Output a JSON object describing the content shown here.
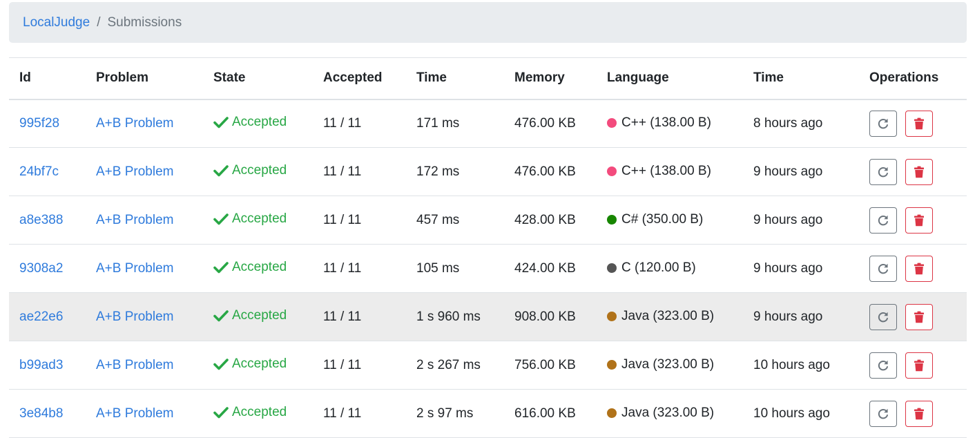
{
  "breadcrumb": {
    "home": "LocalJudge",
    "separator": "/",
    "current": "Submissions"
  },
  "table": {
    "headers": [
      "Id",
      "Problem",
      "State",
      "Accepted",
      "Time",
      "Memory",
      "Language",
      "Time",
      "Operations"
    ],
    "rows": [
      {
        "id": "995f28",
        "problem": "A+B Problem",
        "state": "Accepted",
        "accepted": "11 / 11",
        "time": "171 ms",
        "memory": "476.00 KB",
        "language": "C++ (138.00 B)",
        "lang_color": "#f34b7d",
        "submitted": "8 hours ago"
      },
      {
        "id": "24bf7c",
        "problem": "A+B Problem",
        "state": "Accepted",
        "accepted": "11 / 11",
        "time": "172 ms",
        "memory": "476.00 KB",
        "language": "C++ (138.00 B)",
        "lang_color": "#f34b7d",
        "submitted": "9 hours ago"
      },
      {
        "id": "a8e388",
        "problem": "A+B Problem",
        "state": "Accepted",
        "accepted": "11 / 11",
        "time": "457 ms",
        "memory": "428.00 KB",
        "language": "C# (350.00 B)",
        "lang_color": "#178600",
        "submitted": "9 hours ago"
      },
      {
        "id": "9308a2",
        "problem": "A+B Problem",
        "state": "Accepted",
        "accepted": "11 / 11",
        "time": "105 ms",
        "memory": "424.00 KB",
        "language": "C (120.00 B)",
        "lang_color": "#555555",
        "submitted": "9 hours ago"
      },
      {
        "id": "ae22e6",
        "problem": "A+B Problem",
        "state": "Accepted",
        "accepted": "11 / 11",
        "time": "1 s 960 ms",
        "memory": "908.00 KB",
        "language": "Java (323.00 B)",
        "lang_color": "#b07219",
        "submitted": "9 hours ago"
      },
      {
        "id": "b99ad3",
        "problem": "A+B Problem",
        "state": "Accepted",
        "accepted": "11 / 11",
        "time": "2 s 267 ms",
        "memory": "756.00 KB",
        "language": "Java (323.00 B)",
        "lang_color": "#b07219",
        "submitted": "10 hours ago"
      },
      {
        "id": "3e84b8",
        "problem": "A+B Problem",
        "state": "Accepted",
        "accepted": "11 / 11",
        "time": "2 s 97 ms",
        "memory": "616.00 KB",
        "language": "Java (323.00 B)",
        "lang_color": "#b07219",
        "submitted": "10 hours ago"
      }
    ],
    "hovered_row": 4
  },
  "icons": {
    "state": "check-icon",
    "rejudge": "redo-icon",
    "delete": "trash-icon"
  },
  "colors": {
    "link": "#2f7bdc",
    "accepted": "#28a745",
    "danger": "#dc3545",
    "breadcrumb_bg": "#e9ecef"
  }
}
